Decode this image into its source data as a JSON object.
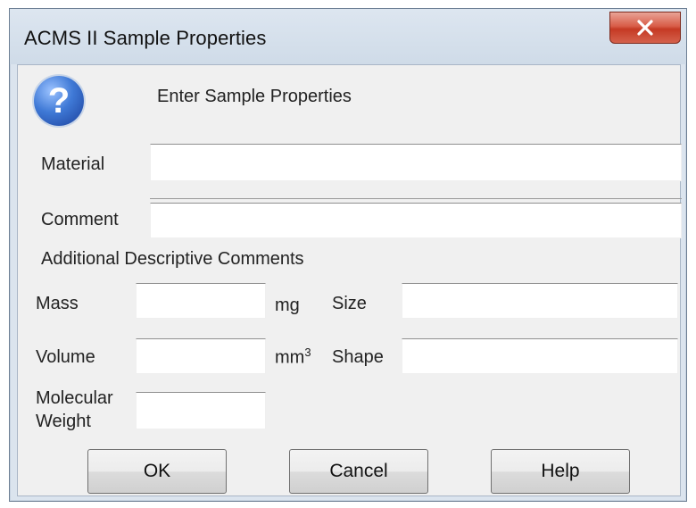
{
  "window": {
    "title": "ACMS II Sample Properties"
  },
  "header": {
    "text": "Enter Sample Properties",
    "icon": "question-icon",
    "icon_glyph": "?"
  },
  "form": {
    "material_label": "Material",
    "material_value": "",
    "comment_label": "Comment",
    "comment_value": "",
    "additional_label": "Additional Descriptive Comments",
    "mass_label": "Mass",
    "mass_value": "",
    "mass_unit": "mg",
    "size_label": "Size",
    "size_value": "",
    "volume_label": "Volume",
    "volume_value": "",
    "volume_unit_base": "mm",
    "volume_unit_sup": "3",
    "shape_label": "Shape",
    "shape_value": "",
    "mw_label_line1": "Molecular",
    "mw_label_line2": "Weight",
    "mw_value": ""
  },
  "buttons": {
    "ok": "OK",
    "cancel": "Cancel",
    "help": "Help"
  },
  "colors": {
    "close_button": "#c53a24",
    "help_icon": "#3f79d6"
  }
}
